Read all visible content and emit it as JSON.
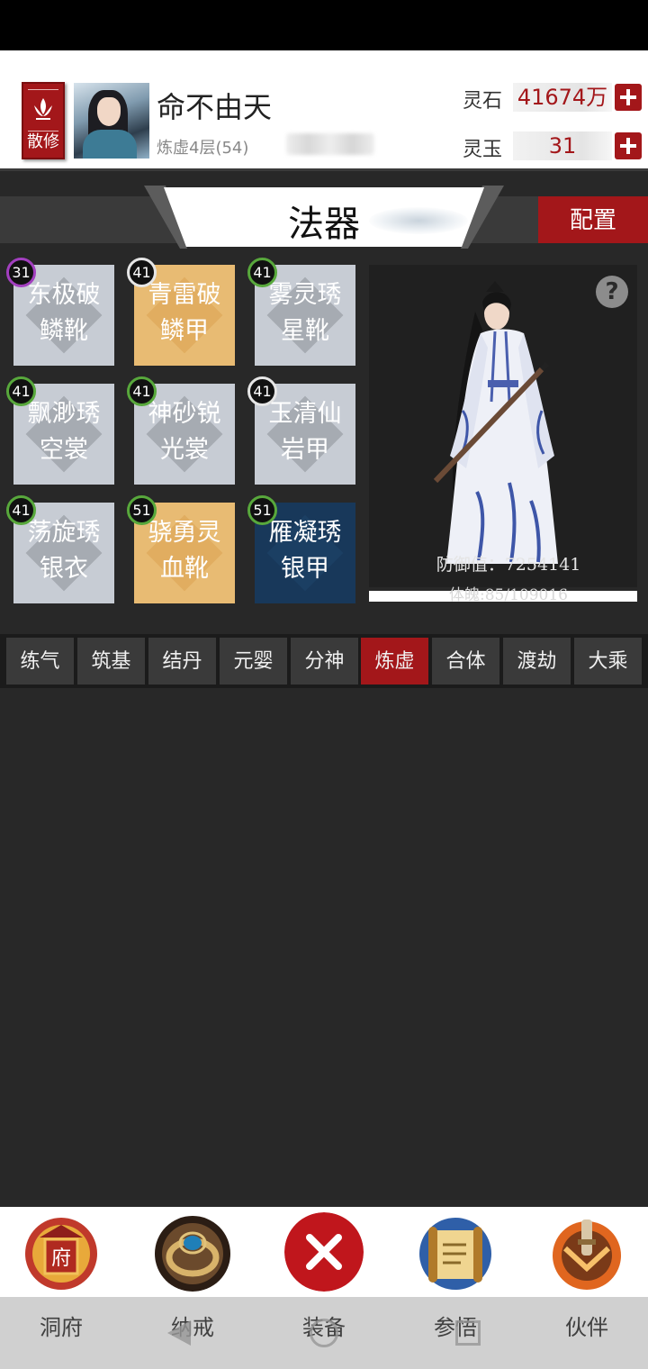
{
  "player": {
    "sect_label": "散修",
    "name": "命不由天",
    "level_text": "炼虚4层(54)"
  },
  "currency": {
    "spirit_stone_label": "灵石",
    "spirit_stone_value": "41674万",
    "spirit_jade_label": "灵玉",
    "spirit_jade_value": "31"
  },
  "page": {
    "title": "法器",
    "config_label": "配置"
  },
  "equipment": [
    {
      "level": "31",
      "name_line1": "东极破",
      "name_line2": "鳞靴",
      "quality": "gray",
      "ring": "purple"
    },
    {
      "level": "41",
      "name_line1": "青雷破",
      "name_line2": "鳞甲",
      "quality": "gold",
      "ring": "white"
    },
    {
      "level": "41",
      "name_line1": "雾灵琇",
      "name_line2": "星靴",
      "quality": "gray",
      "ring": "green"
    },
    {
      "level": "41",
      "name_line1": "飘渺琇",
      "name_line2": "空裳",
      "quality": "gray",
      "ring": "green"
    },
    {
      "level": "41",
      "name_line1": "神砂锐",
      "name_line2": "光裳",
      "quality": "gray",
      "ring": "green"
    },
    {
      "level": "41",
      "name_line1": "玉清仙",
      "name_line2": "岩甲",
      "quality": "gray",
      "ring": "white"
    },
    {
      "level": "41",
      "name_line1": "荡旋琇",
      "name_line2": "银衣",
      "quality": "gray",
      "ring": "green"
    },
    {
      "level": "51",
      "name_line1": "骁勇灵",
      "name_line2": "血靴",
      "quality": "gold",
      "ring": "green"
    },
    {
      "level": "51",
      "name_line1": "雁凝琇",
      "name_line2": "银甲",
      "quality": "navy",
      "ring": "green"
    }
  ],
  "preview": {
    "help_icon": "?",
    "defense_text": "防御值：7254141",
    "hp_text": "体魄:85/109016"
  },
  "realms": [
    "练气",
    "筑基",
    "结丹",
    "元婴",
    "分神",
    "炼虚",
    "合体",
    "渡劫",
    "大乘"
  ],
  "active_realm": "炼虚",
  "nav": [
    {
      "label": "洞府",
      "icon": "cave-mansion-icon"
    },
    {
      "label": "纳戒",
      "icon": "storage-ring-icon"
    },
    {
      "label": "装备",
      "icon": "close-icon"
    },
    {
      "label": "参悟",
      "icon": "scroll-icon"
    },
    {
      "label": "伙伴",
      "icon": "companion-icon"
    }
  ],
  "nav_sign_text": "府",
  "colors": {
    "accent_red": "#a3171a",
    "gray_tile": "#c7ccd4",
    "gold_tile": "#e8bb73",
    "navy_tile": "#18385a"
  }
}
